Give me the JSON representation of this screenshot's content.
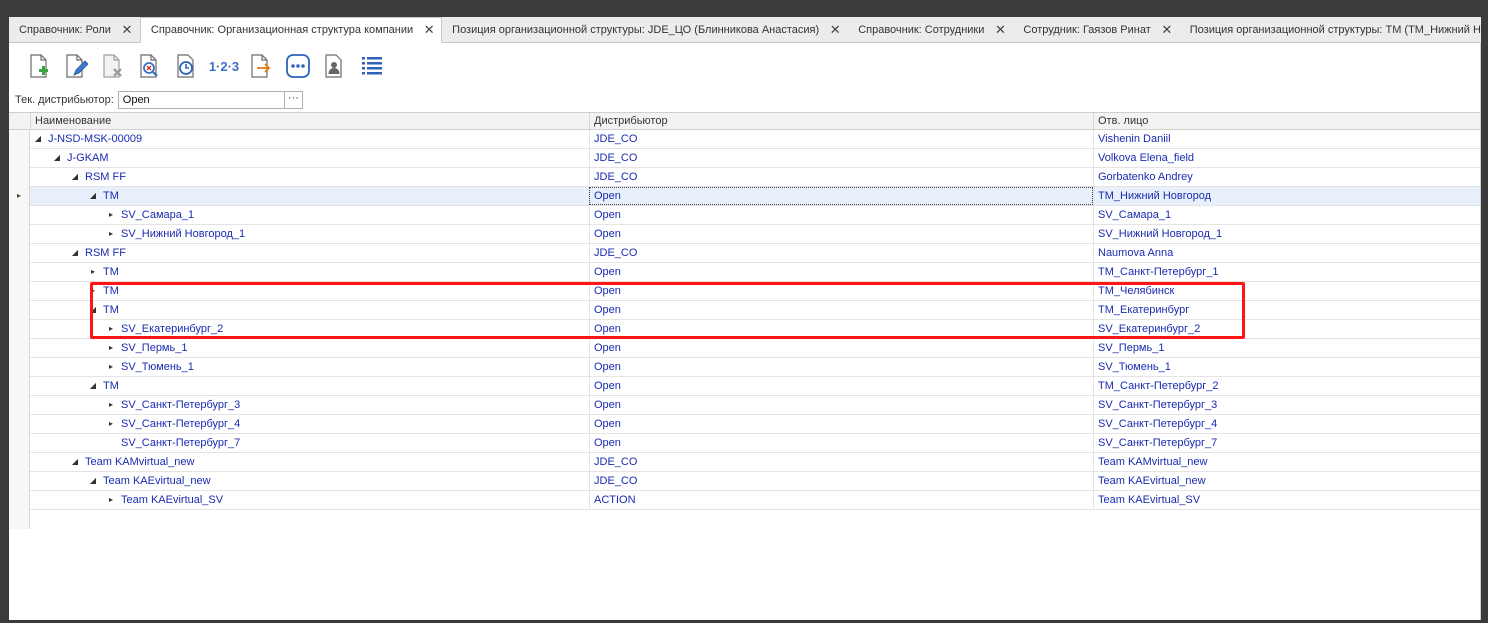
{
  "tabs": [
    {
      "label": "Справочник: Роли",
      "active": false
    },
    {
      "label": "Справочник: Организационная структура компании",
      "active": true
    },
    {
      "label": "Позиция организационной структуры:  JDE_ЦО (Блинникова Анастасия)",
      "active": false
    },
    {
      "label": "Справочник: Сотрудники",
      "active": false
    },
    {
      "label": "Сотрудник:  Гаязов Ринат",
      "active": false
    },
    {
      "label": "Позиция организационной структуры:  ТМ (ТМ_Нижний Новгород)",
      "active": false
    }
  ],
  "tab_close_glyph": "✕",
  "toolbar": {
    "buttons": [
      {
        "name": "add-record",
        "icon": "add-document-icon"
      },
      {
        "name": "edit-record",
        "icon": "edit-document-icon"
      },
      {
        "name": "delete-record",
        "icon": "delete-document-icon"
      },
      {
        "name": "search-record",
        "icon": "search-document-icon"
      },
      {
        "name": "history",
        "icon": "clock-icon"
      },
      {
        "name": "numbering",
        "icon": "numbers-icon",
        "text": "1·2·3"
      },
      {
        "name": "export",
        "icon": "export-document-icon"
      },
      {
        "name": "more",
        "icon": "more-icon"
      },
      {
        "name": "employee-card",
        "icon": "person-card-icon"
      },
      {
        "name": "list-view",
        "icon": "list-icon"
      }
    ]
  },
  "distributor": {
    "label": "Тек. дистрибьютор:",
    "value": "Open",
    "button": "···"
  },
  "grid": {
    "columns": [
      "Наименование",
      "Дистрибьютор",
      "Отв. лицо"
    ],
    "rows": [
      {
        "name": "J-NSD-MSK-00009",
        "dist": "JDE_CO",
        "resp": "Vishenin Daniil",
        "level": 0,
        "exp": "open"
      },
      {
        "name": "J-GKAM",
        "dist": "JDE_CO",
        "resp": "Volkova Elena_field",
        "level": 1,
        "exp": "open"
      },
      {
        "name": "RSM FF",
        "dist": "JDE_CO",
        "resp": "Gorbatenko Andrey",
        "level": 2,
        "exp": "open"
      },
      {
        "name": "TM",
        "dist": "Open",
        "resp": "ТМ_Нижний Новгород",
        "level": 3,
        "exp": "open",
        "selected": true
      },
      {
        "name": "SV_Самара_1",
        "dist": "Open",
        "resp": "SV_Самара_1",
        "level": 4,
        "exp": "closed"
      },
      {
        "name": "SV_Нижний Новгород_1",
        "dist": "Open",
        "resp": "SV_Нижний Новгород_1",
        "level": 4,
        "exp": "closed"
      },
      {
        "name": "RSM FF",
        "dist": "JDE_CO",
        "resp": "Naumova Anna",
        "level": 2,
        "exp": "open"
      },
      {
        "name": "TM",
        "dist": "Open",
        "resp": "ТМ_Санкт-Петербург_1",
        "level": 3,
        "exp": "closed"
      },
      {
        "name": "TM",
        "dist": "Open",
        "resp": "ТМ_Челябинск",
        "level": 3,
        "exp": "closed"
      },
      {
        "name": "TM",
        "dist": "Open",
        "resp": "ТМ_Екатеринбург",
        "level": 3,
        "exp": "open"
      },
      {
        "name": "SV_Екатеринбург_2",
        "dist": "Open",
        "resp": "SV_Екатеринбург_2",
        "level": 4,
        "exp": "closed"
      },
      {
        "name": "SV_Пермь_1",
        "dist": "Open",
        "resp": "SV_Пермь_1",
        "level": 4,
        "exp": "closed"
      },
      {
        "name": "SV_Тюмень_1",
        "dist": "Open",
        "resp": "SV_Тюмень_1",
        "level": 4,
        "exp": "closed"
      },
      {
        "name": "TM",
        "dist": "Open",
        "resp": "ТМ_Санкт-Петербург_2",
        "level": 3,
        "exp": "open"
      },
      {
        "name": "SV_Санкт-Петербург_3",
        "dist": "Open",
        "resp": "SV_Санкт-Петербург_3",
        "level": 4,
        "exp": "closed"
      },
      {
        "name": "SV_Санкт-Петербург_4",
        "dist": "Open",
        "resp": "SV_Санкт-Петербург_4",
        "level": 4,
        "exp": "closed"
      },
      {
        "name": "SV_Санкт-Петербург_7",
        "dist": "Open",
        "resp": "SV_Санкт-Петербург_7",
        "level": 4,
        "exp": "none"
      },
      {
        "name": "Team KAMvirtual_new",
        "dist": "JDE_CO",
        "resp": "Team KAMvirtual_new",
        "level": 2,
        "exp": "open"
      },
      {
        "name": "Team KAEvirtual_new",
        "dist": "JDE_CO",
        "resp": "Team KAEvirtual_new",
        "level": 3,
        "exp": "open"
      },
      {
        "name": "Team KAEvirtual_SV",
        "dist": "ACTION",
        "resp": "Team KAEvirtual_SV",
        "level": 4,
        "exp": "closed"
      }
    ]
  },
  "colors": {
    "link_text": "#1a2bb0",
    "highlight_box": "#ff1515",
    "selected_row": "#e8f1fb"
  }
}
